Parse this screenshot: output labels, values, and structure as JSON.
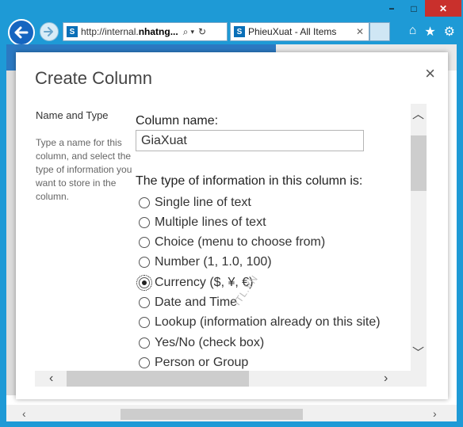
{
  "browser": {
    "address_prefix": "http://internal.",
    "address_host": "nhatng...",
    "tab_title": "PhieuXuat - All Items",
    "icons": [
      "back-arrow-icon",
      "forward-arrow-icon",
      "search-icon",
      "refresh-icon",
      "home-icon",
      "favorites-star-icon",
      "settings-gear-icon"
    ]
  },
  "window_controls": {
    "minimize": "−",
    "maximize": "□",
    "close": "✕"
  },
  "dialog": {
    "title": "Create Column",
    "close": "×",
    "section_title": "Name and Type",
    "section_desc": "Type a name for this column, and select the type of information you want to store in the column.",
    "column_name_label": "Column name:",
    "column_name_value": "GiaXuat",
    "type_label": "The type of information in this column is:",
    "watermark": "ITL.VN",
    "options": [
      {
        "label": "Single line of text",
        "checked": false
      },
      {
        "label": "Multiple lines of text",
        "checked": false
      },
      {
        "label": "Choice (menu to choose from)",
        "checked": false
      },
      {
        "label": "Number (1, 1.0, 100)",
        "checked": false
      },
      {
        "label": "Currency ($, ¥, €)",
        "checked": true
      },
      {
        "label": "Date and Time",
        "checked": false
      },
      {
        "label": "Lookup (information already on this site)",
        "checked": false
      },
      {
        "label": "Yes/No (check box)",
        "checked": false
      },
      {
        "label": "Person or Group",
        "checked": false
      }
    ]
  },
  "accent_color": "#1e9ad6"
}
